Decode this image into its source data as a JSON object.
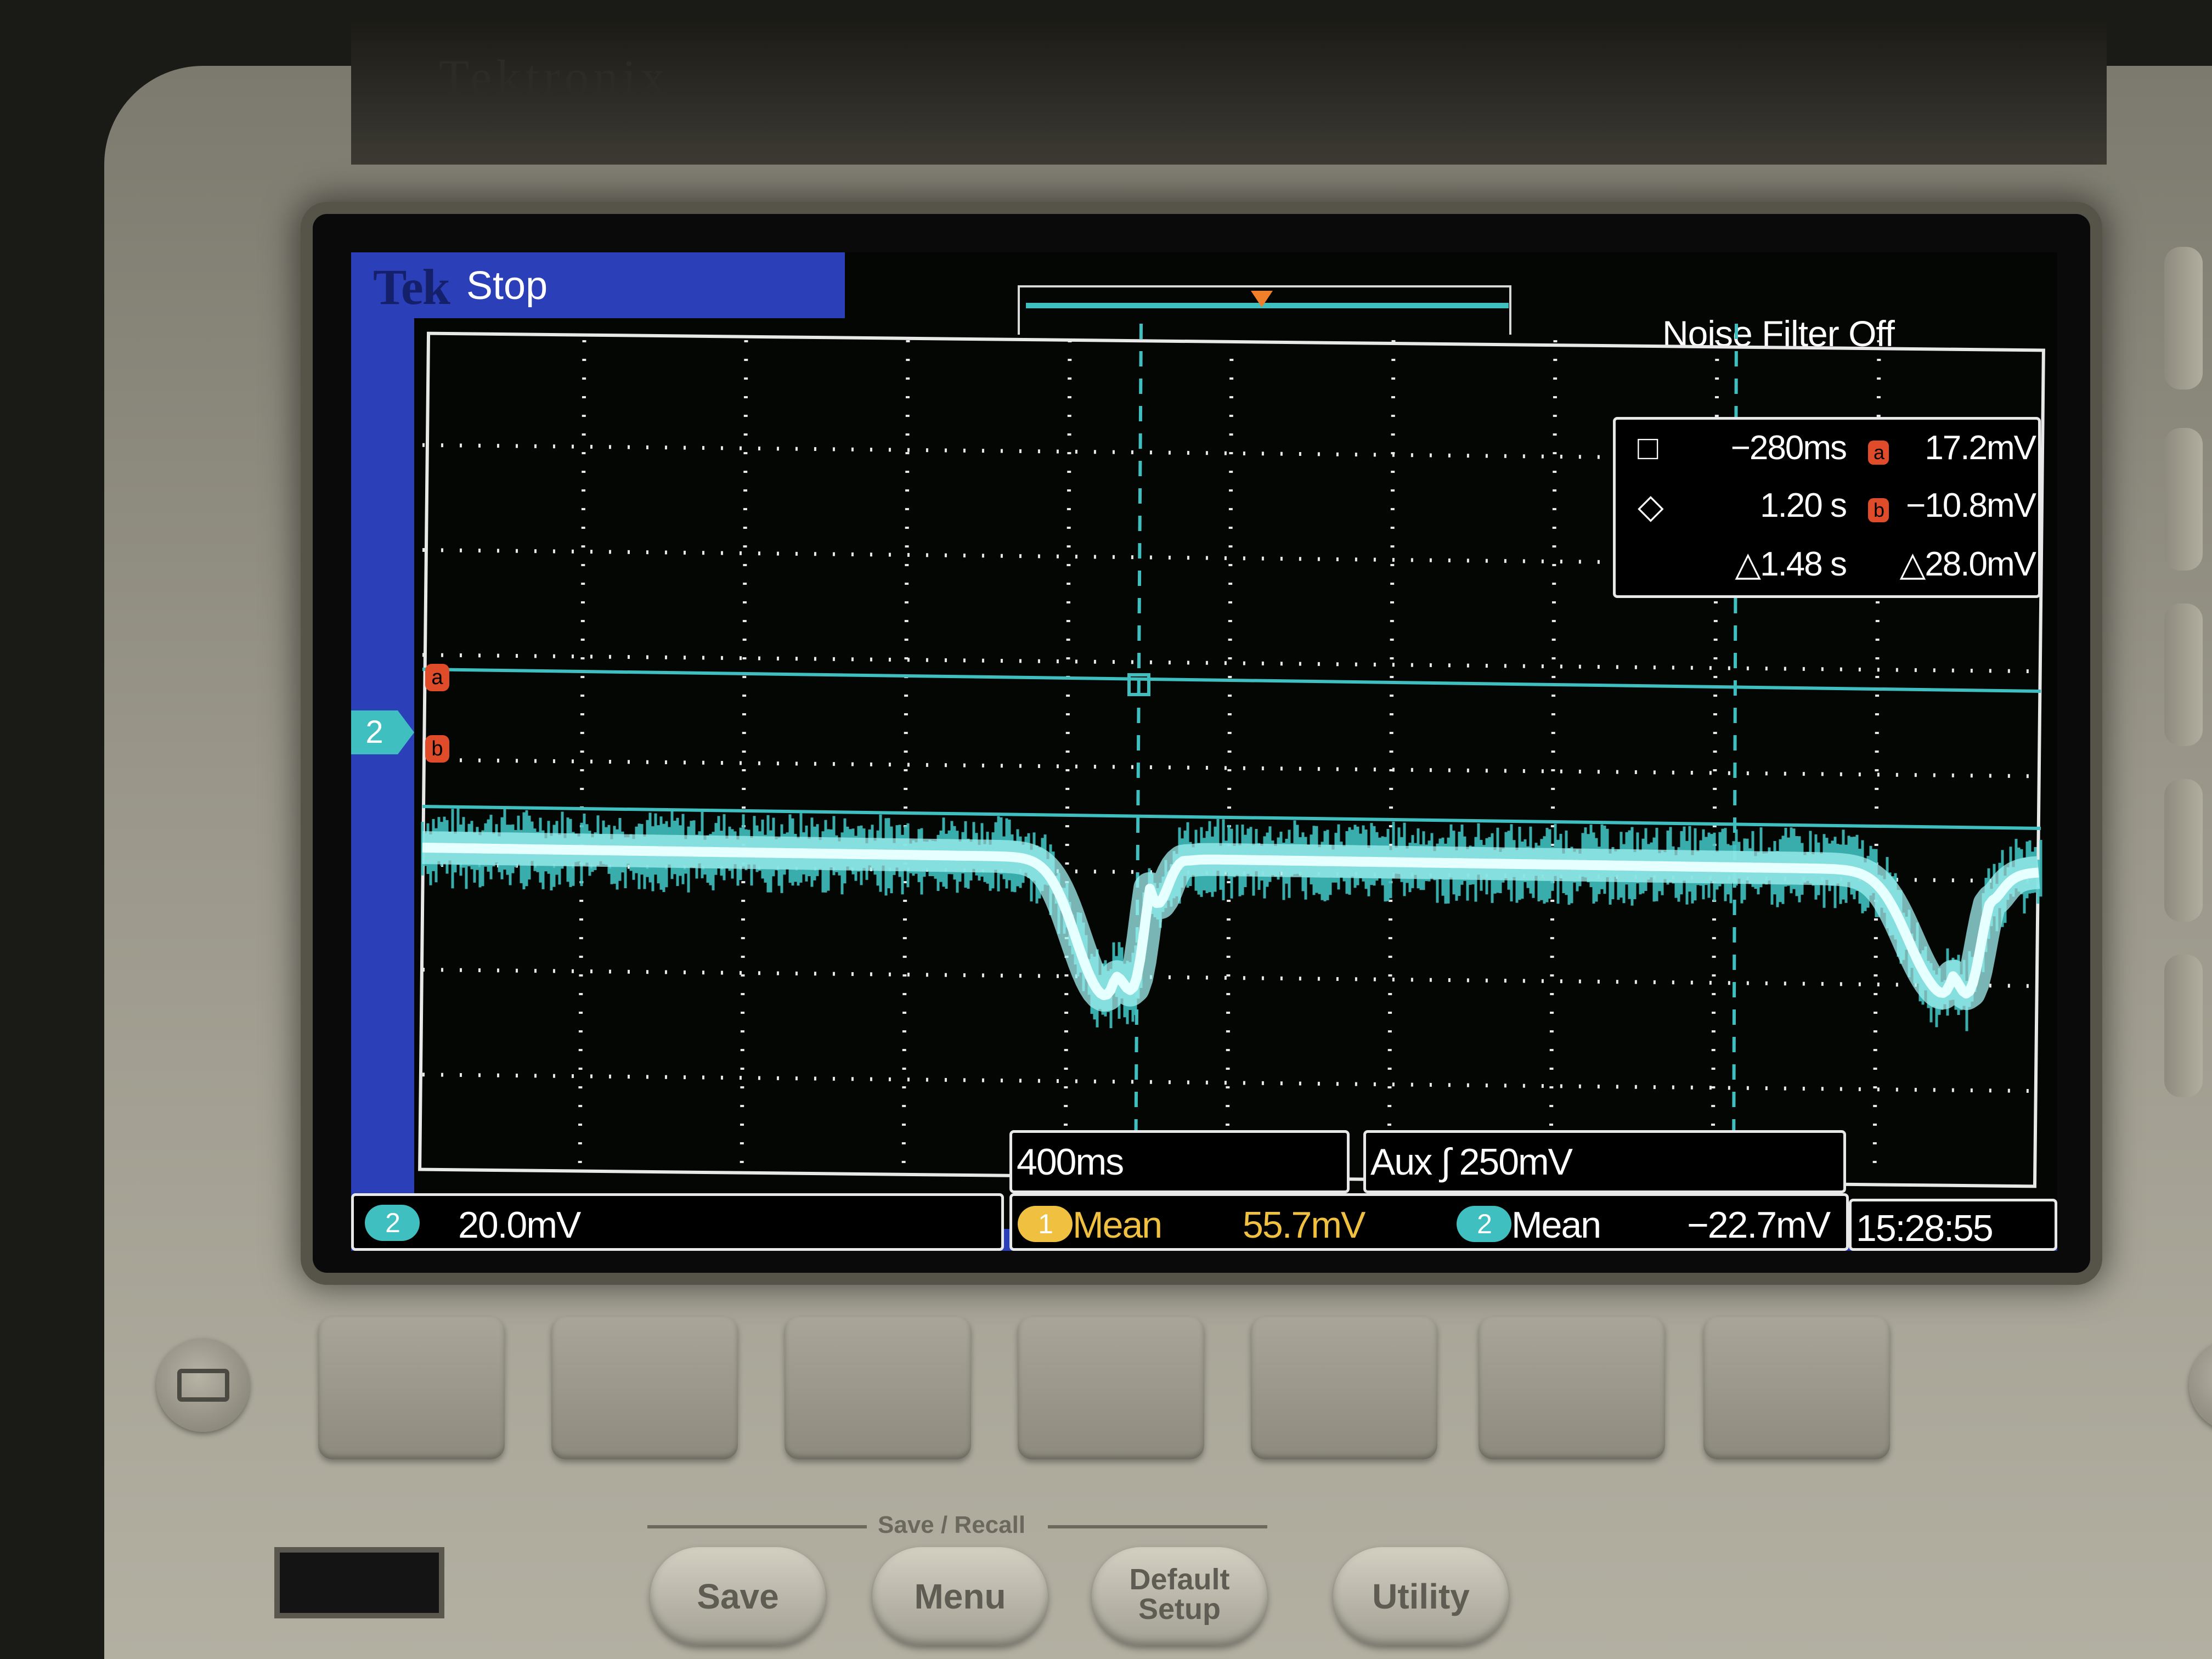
{
  "scope": {
    "brand": "Tek",
    "run_state": "Stop",
    "noise_filter": "Noise Filter Off",
    "channel_marker": "2",
    "cursor_readout": {
      "cursor1_symbol": "□",
      "cursor1_time": "−280ms",
      "cursor1_badge": "a",
      "cursor1_value": "17.2mV",
      "cursor2_symbol": "◇",
      "cursor2_time": "1.20 s",
      "cursor2_badge": "b",
      "cursor2_value": "−10.8mV",
      "delta_time": "△1.48 s",
      "delta_value": "△28.0mV"
    },
    "cursor_tag_a": "a",
    "cursor_tag_b": "b",
    "timebase": "400ms",
    "trigger": "Aux  ∫ 250mV",
    "ch2_number": "2",
    "ch2_scale": "20.0mV",
    "meas1_channel": "1",
    "meas1_label": "Mean",
    "meas1_value": "55.7mV",
    "meas2_channel": "2",
    "meas2_label": "Mean",
    "meas2_value": "−22.7mV",
    "clock": "15:28:55"
  },
  "front_panel": {
    "group_label": "Save / Recall",
    "save_button": "Save",
    "menu_button": "Menu",
    "default_setup_line1": "Default",
    "default_setup_line2": "Setup",
    "utility_button": "Utility"
  },
  "colors": {
    "trace": "#3fbfbf",
    "ch1": "#f0c040",
    "cursor": "#e04c2a",
    "screen_blue": "#2a3fb8"
  }
}
